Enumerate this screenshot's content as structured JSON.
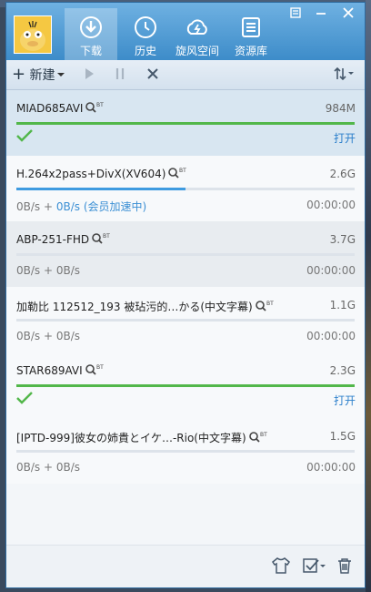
{
  "nav": {
    "tabs": [
      {
        "label": "下载",
        "icon": "download-icon",
        "active": true
      },
      {
        "label": "历史",
        "icon": "history-icon",
        "active": false
      },
      {
        "label": "旋风空间",
        "icon": "cloud-icon",
        "active": false
      },
      {
        "label": "资源库",
        "icon": "library-icon",
        "active": false
      }
    ]
  },
  "toolbar": {
    "new_label": "新建"
  },
  "downloads": [
    {
      "name": "MIAD685AVI",
      "size": "984M",
      "progress": 1.0,
      "completed": true,
      "action": "打开"
    },
    {
      "name": "H.264x2pass+DivX(XV604)",
      "size": "2.6G",
      "progress": 0.5,
      "speed": "0B/s + ",
      "accel": "0B/s (会员加速中)",
      "time": "00:00:00"
    },
    {
      "name": "ABP-251-FHD",
      "size": "3.7G",
      "progress": 0.0,
      "speed": "0B/s + 0B/s",
      "time": "00:00:00"
    },
    {
      "name": "加勒比 112512_193 被玷污的…かる(中文字幕)",
      "size": "1.1G",
      "progress": 0.0,
      "speed": "0B/s + 0B/s",
      "time": "00:00:00"
    },
    {
      "name": "STAR689AVI",
      "size": "2.3G",
      "progress": 1.0,
      "completed": true,
      "action": "打开"
    },
    {
      "name": "[IPTD-999]彼女の姉貴とイケ…-Rio(中文字幕)",
      "size": "1.5G",
      "progress": 0.0,
      "speed": "0B/s + 0B/s",
      "time": "00:00:00"
    }
  ],
  "colors": {
    "accent": "#3d8cc9",
    "complete": "#52b74a",
    "link": "#2b7fcb"
  }
}
